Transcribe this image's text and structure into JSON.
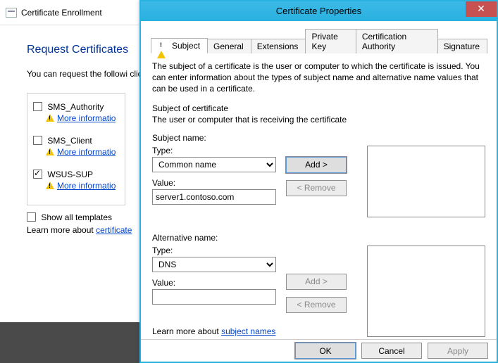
{
  "back": {
    "title": "Certificate Enrollment",
    "heading": "Request Certificates",
    "desc": "You can request the followi click Enroll.",
    "templates": [
      {
        "label": "SMS_Authority",
        "checked": false
      },
      {
        "label": "SMS_Client",
        "checked": false
      },
      {
        "label": "WSUS-SUP",
        "checked": true
      }
    ],
    "more_info": "More informatio",
    "show_all": "Show all templates",
    "learn_prefix": "Learn more about ",
    "learn_link": "certificate"
  },
  "dialog": {
    "title": "Certificate Properties",
    "close": "✕",
    "tabs": {
      "subject": "Subject",
      "general": "General",
      "extensions": "Extensions",
      "private_key": "Private Key",
      "ca": "Certification Authority",
      "signature": "Signature"
    },
    "helptext": "The subject of a certificate is the user or computer to which the certificate is issued. You can enter information about the types of subject name and alternative name values that can be used in a certificate.",
    "subj_of_cert": "Subject of certificate",
    "subj_desc": "The user or computer that is receiving the certificate",
    "subject": {
      "group": "Subject name:",
      "type_label": "Type:",
      "type_value": "Common name",
      "value_label": "Value:",
      "value_value": "server1.contoso.com",
      "add": "Add >",
      "remove": "< Remove"
    },
    "alt": {
      "group": "Alternative name:",
      "type_label": "Type:",
      "type_value": "DNS",
      "value_label": "Value:",
      "value_value": "",
      "add": "Add >",
      "remove": "< Remove"
    },
    "learn_prefix": "Learn more about ",
    "learn_link": "subject names",
    "buttons": {
      "ok": "OK",
      "cancel": "Cancel",
      "apply": "Apply"
    }
  }
}
